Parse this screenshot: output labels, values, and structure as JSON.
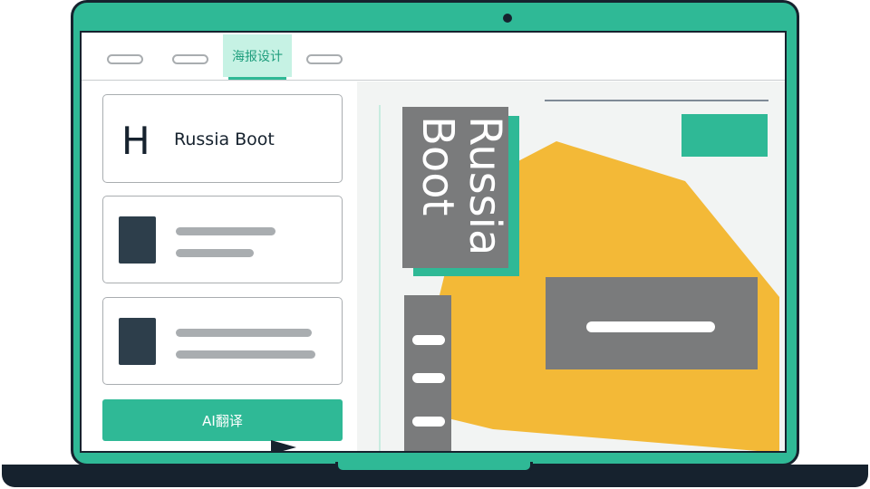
{
  "topbar": {
    "active_tab_label": "海报设计"
  },
  "left_panel": {
    "title_card": {
      "icon_letter": "H",
      "text": "Russia Boot"
    },
    "translate_button_label": "AI翻译"
  },
  "poster": {
    "vertical_title": "Russia\nBoot"
  },
  "colors": {
    "accent_green": "#2fb996",
    "dark_navy": "#16222e",
    "poster_yellow": "#f3b937",
    "block_gray": "#7a7b7c",
    "placeholder_gray": "#a9adb0"
  },
  "icons": {
    "cursor": "mouse-pointer-icon",
    "heading": "heading-letter-icon"
  }
}
